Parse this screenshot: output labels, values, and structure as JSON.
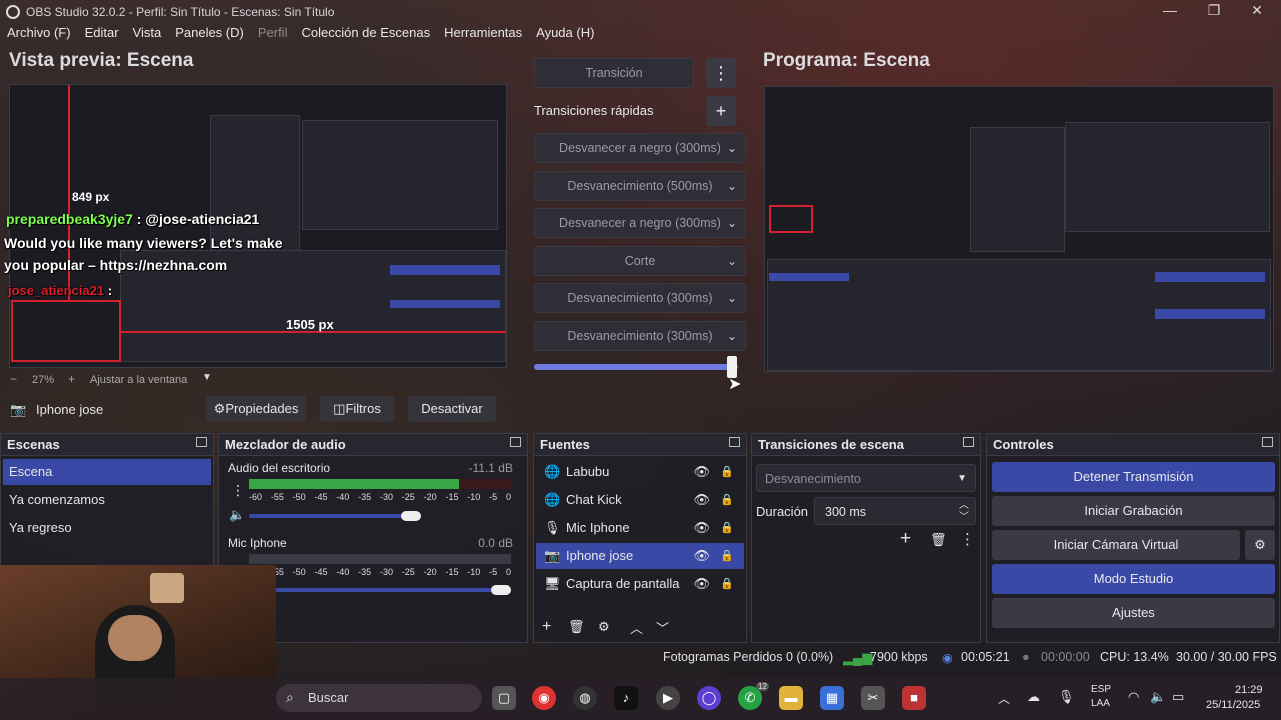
{
  "window": {
    "title": "OBS Studio 32.0.2 - Perfil: Sin Título - Escenas: Sin Título",
    "minimize": "—",
    "maximize": "❐",
    "close": "✕"
  },
  "menu": [
    "Archivo (F)",
    "Editar",
    "Vista",
    "Paneles (D)",
    "Perfil",
    "Colección de Escenas",
    "Herramientas",
    "Ayuda (H)"
  ],
  "preview": {
    "title": "Vista previa: Escena",
    "zoom": "27%",
    "fit": "Ajustar a la ventana",
    "dim_w": "849 px",
    "dim_h": "1505 px",
    "chat": {
      "user1": "preparedbeak3yje7",
      "mention": " : @jose-atiencia21",
      "line2": "Would you like many viewers? Let's make",
      "line3": "you popular – https://nezhna.com",
      "user2": "jose_atiencia21",
      "sep": " : "
    }
  },
  "transition_panel": {
    "transition_btn": "Transición",
    "quick_title": "Transiciones rápidas",
    "items": [
      "Desvanecer a negro (300ms)",
      "Desvanecimiento (500ms)",
      "Desvanecer a negro (300ms)",
      "Corte",
      "Desvanecimiento (300ms)",
      "Desvanecimiento (300ms)"
    ],
    "tbar_level": 0.97
  },
  "program": {
    "title": "Programa: Escena"
  },
  "source_toolbar": {
    "source_name": "Iphone jose",
    "properties": "Propiedades",
    "filters": "Filtros",
    "deactivate": "Desactivar"
  },
  "docks": {
    "scenes": {
      "title": "Escenas",
      "items": [
        "Escena",
        "Ya comenzamos",
        "Ya regreso"
      ]
    },
    "mixer": {
      "title": "Mezclador de audio",
      "channels": [
        {
          "name": "Audio del escritorio",
          "db": "-11.1 dB",
          "level": 0.8,
          "volume": 0.9
        },
        {
          "name": "Mic Iphone",
          "db": "0.0 dB",
          "level": 0.0,
          "volume": 1.0
        }
      ],
      "ticks": [
        "-60",
        "-55",
        "-50",
        "-45",
        "-40",
        "-35",
        "-30",
        "-25",
        "-20",
        "-15",
        "-10",
        "-5",
        "0"
      ]
    },
    "sources": {
      "title": "Fuentes",
      "items": [
        {
          "label": "Labubu",
          "icon": "browser-icon"
        },
        {
          "label": "Chat Kick",
          "icon": "browser-icon"
        },
        {
          "label": "Mic Iphone",
          "icon": "mic-icon"
        },
        {
          "label": "Iphone jose",
          "icon": "camera-icon"
        },
        {
          "label": "Captura de pantalla",
          "icon": "monitor-icon"
        }
      ]
    },
    "scene_transitions": {
      "title": "Transiciones de escena",
      "select": "Desvanecimiento",
      "duration_label": "Duración",
      "duration_value": "300 ms"
    },
    "controls": {
      "title": "Controles",
      "stop_stream": "Detener Transmisión",
      "start_recording": "Iniciar Grabación",
      "virtual_cam": "Iniciar Cámara Virtual",
      "studio_mode": "Modo Estudio",
      "settings": "Ajustes"
    }
  },
  "statusbar": {
    "dropped": "Fotogramas Perdidos 0 (0.0%)",
    "bitrate": "7900 kbps",
    "stream_time": "00:05:21",
    "rec_time": "00:00:00",
    "cpu": "CPU: 13.4%",
    "fps": "30.00 / 30.00 FPS"
  },
  "taskbar": {
    "search": "Buscar",
    "lang1": "ESP",
    "lang2": "LAA",
    "time": "21:29",
    "date": "25/11/2025",
    "badge": "12"
  },
  "colors": {
    "accent": "#3a49a6",
    "meter_green": "#3aa545",
    "red_outline": "#d4212b",
    "chat_green": "#7fff4f"
  }
}
